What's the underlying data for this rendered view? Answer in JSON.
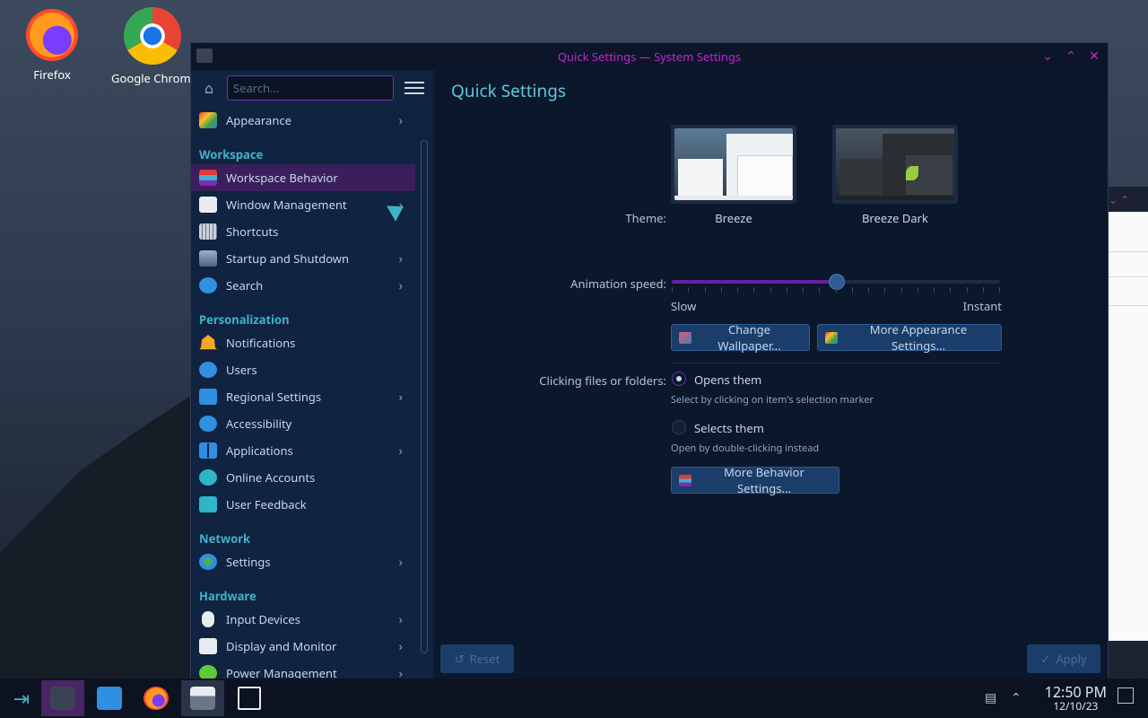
{
  "desktop": {
    "icons": [
      {
        "label": "Firefox"
      },
      {
        "label": "Google Chrome"
      }
    ]
  },
  "window": {
    "title": "Quick Settings — System Settings",
    "controls": {
      "minimize": "⌄",
      "maximize": "⌃",
      "close": "✕"
    }
  },
  "sidebar": {
    "search_placeholder": "Search...",
    "items": {
      "appearance": "Appearance",
      "workspace_header": "Workspace",
      "workspace_behavior": "Workspace Behavior",
      "window_management": "Window Management",
      "shortcuts": "Shortcuts",
      "startup_shutdown": "Startup and Shutdown",
      "search": "Search",
      "personalization_header": "Personalization",
      "notifications": "Notifications",
      "users": "Users",
      "regional_settings": "Regional Settings",
      "accessibility": "Accessibility",
      "applications": "Applications",
      "online_accounts": "Online Accounts",
      "user_feedback": "User Feedback",
      "network_header": "Network",
      "settings": "Settings",
      "hardware_header": "Hardware",
      "input_devices": "Input Devices",
      "display_monitor": "Display and Monitor",
      "power_management": "Power Management"
    }
  },
  "content": {
    "title": "Quick Settings",
    "theme_label": "Theme:",
    "themes": [
      {
        "name": "Breeze"
      },
      {
        "name": "Breeze Dark"
      }
    ],
    "animation_label": "Animation speed:",
    "animation_value": 0.5,
    "slow_label": "Slow",
    "instant_label": "Instant",
    "change_wallpaper": "Change Wallpaper...",
    "more_appearance": "More Appearance Settings...",
    "clicking_label": "Clicking files or folders:",
    "opens_them": "Opens them",
    "opens_hint": "Select by clicking on item's selection marker",
    "selects_them": "Selects them",
    "selects_hint": "Open by double-clicking instead",
    "more_behavior": "More Behavior Settings...",
    "reset": "Reset",
    "apply": "Apply"
  },
  "taskbar": {
    "time": "12:50 PM",
    "date": "12/10/23"
  },
  "colors": {
    "accent": "#c026d3",
    "section": "#3fb2c9",
    "active_item": "#3a1f5c"
  }
}
